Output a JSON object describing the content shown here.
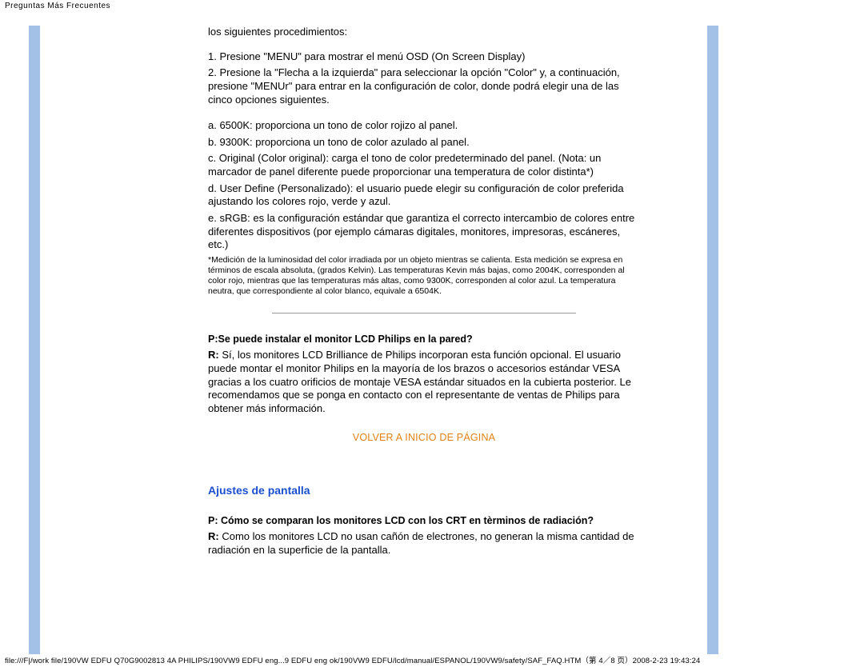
{
  "page_header": "Preguntas Más Frecuentes",
  "intro_line": "los siguientes procedimientos:",
  "step1": "1. Presione \"MENU\" para mostrar el menú OSD (On Screen Display)",
  "step2": "2. Presione la \"Flecha a la izquierda\" para seleccionar la opción \"Color\" y, a continuación, presione \"MENUr\" para entrar en la configuración de color, donde podrá elegir una de las cinco opciones siguientes.",
  "opt_a": "a. 6500K: proporciona un tono de color rojizo al panel.",
  "opt_b": "b. 9300K: proporciona un tono de color azulado al panel.",
  "opt_c": "c. Original (Color original): carga el tono de color predeterminado del panel. (Nota: un marcador de panel diferente puede proporcionar una temperatura de color distinta*)",
  "opt_d": "d. User Define (Personalizado): el usuario puede elegir su configuración de color preferida ajustando los colores rojo, verde y azul.",
  "opt_e": "e. sRGB: es la configuración estándar que garantiza el correcto intercambio de colores entre diferentes dispositivos (por ejemplo cámaras digitales, monitores, impresoras, escáneres, etc.)",
  "note": "*Medición de la luminosidad del color irradiada por un objeto mientras se calienta. Esta medición se expresa en términos de escala absoluta, (grados Kelvin). Las temperaturas Kevin más bajas, como 2004K, corresponden al color rojo, mientras que las temperaturas más altas, como 9300K, corresponden al color azul. La temperatura neutra, que correspondiente al color blanco, equivale a 6504K.",
  "q1_p": "P:",
  "q1_text": "Se puede instalar el monitor LCD Philips en la pared?",
  "r_label": "R:",
  "q1_answer": " Sí, los monitores LCD Brilliance de Philips incorporan esta función opcional. El usuario puede montar el monitor Philips en la mayoría de los brazos o accesorios estándar VESA gracias a los cuatro orificios de montaje VESA estándar situados en la cubierta posterior. Le recomendamos que se ponga en contacto con el representante de ventas de Philips para obtener más información.",
  "back_to_top": "VOLVER A INICIO DE PÁGINA",
  "section_heading": "Ajustes de pantalla",
  "q2_p": "P:",
  "q2_text": " Cómo se comparan los monitores LCD con los CRT en tèrminos de radiación?",
  "q2_answer": " Como los monitores LCD no usan cañón de electrones, no generan la misma cantidad de radiación en la superficie de la pantalla.",
  "page_footer": "file:///F|/work file/190VW EDFU Q70G9002813 4A PHILIPS/190VW9 EDFU eng...9 EDFU eng ok/190VW9 EDFU/lcd/manual/ESPANOL/190VW9/safety/SAF_FAQ.HTM（第 4／8 页）2008-2-23 19:43:24"
}
